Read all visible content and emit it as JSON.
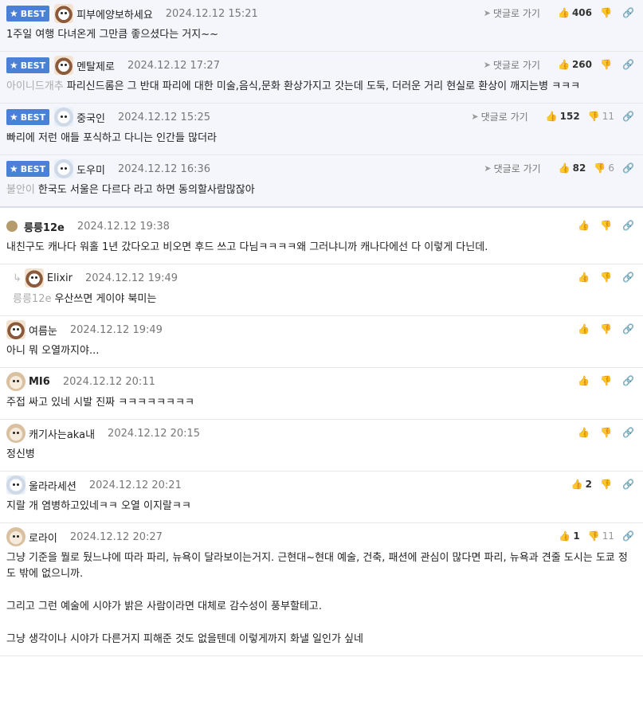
{
  "labels": {
    "best": "BEST",
    "goto": "댓글로 가기"
  },
  "best_comments": [
    {
      "nick": "피부에양보하세요",
      "date": "2024.12.12 15:21",
      "up": "406",
      "down": "",
      "ref": "",
      "text": "1주일 여행 다녀온게 그만큼 좋으셨다는 거지~~"
    },
    {
      "nick": "멘탈제로",
      "date": "2024.12.12 17:27",
      "up": "260",
      "down": "",
      "ref": "아이니드개추",
      "text": "파리신드롬은 그 반대 파리에 대한 미술,음식,문화 환상가지고 갓는데 도둑, 더러운 거리 현실로 환상이 깨지는병 ㅋㅋㅋ"
    },
    {
      "nick": "중국인",
      "date": "2024.12.12 15:25",
      "up": "152",
      "down": "11",
      "ref": "",
      "text": "빠리에 저런 애들 포식하고 다니는 인간들 많더라"
    },
    {
      "nick": "도우미",
      "date": "2024.12.12 16:36",
      "up": "82",
      "down": "6",
      "ref": "불안이",
      "text": "한국도 서울은 다르다 라고 하면 동의할사람많잖아"
    }
  ],
  "comments": [
    {
      "nick": "릉릉12e",
      "date": "2024.12.12 19:38",
      "up": "",
      "down": "",
      "ref": "",
      "text": [
        "내친구도 캐나다 워홀 1년 갔다오고 비오면 후드 쓰고 다님ㅋㅋㅋㅋ왜 그러냐니까 캐나다에선 다 이렇게 다닌데."
      ]
    },
    {
      "nick": "Elixir",
      "date": "2024.12.12 19:49",
      "up": "",
      "down": "",
      "ref": "릉릉12e",
      "text": [
        "우산쓰면 게이야 북미는"
      ]
    },
    {
      "nick": "여름눈",
      "date": "2024.12.12 19:49",
      "up": "",
      "down": "",
      "ref": "",
      "text": [
        "아니 뭐 오열까지야..."
      ]
    },
    {
      "nick": "MI6",
      "date": "2024.12.12 20:11",
      "up": "",
      "down": "",
      "ref": "",
      "text": [
        "주접 싸고 있네 시발 진짜 ㅋㅋㅋㅋㅋㅋㅋㅋ"
      ]
    },
    {
      "nick": "캐기사는aka내",
      "date": "2024.12.12 20:15",
      "up": "",
      "down": "",
      "ref": "",
      "text": [
        "정신병"
      ]
    },
    {
      "nick": "울라라세션",
      "date": "2024.12.12 20:21",
      "up": "2",
      "down": "",
      "ref": "",
      "text": [
        "지랄 개 염병하고있네ㅋㅋ 오열 이지랄ㅋㅋ"
      ]
    },
    {
      "nick": "로라이",
      "date": "2024.12.12 20:27",
      "up": "1",
      "down": "11",
      "ref": "",
      "text": [
        "그냥 기준을 뭘로 뒀느냐에 따라 파리, 뉴욕이 달라보이는거지. 근현대~현대 예술, 건축, 패션에 관심이 많다면 파리, 뉴욕과 견줄 도시는 도쿄 정도 밖에 없으니까.",
        "그리고 그런 예술에 시야가 밝은 사람이라면 대체로 감수성이 풍부할테고.",
        "그냥 생각이나 시야가 다른거지 피해준 것도 없을텐데 이렇게까지 화낼 일인가 싶네"
      ]
    }
  ]
}
